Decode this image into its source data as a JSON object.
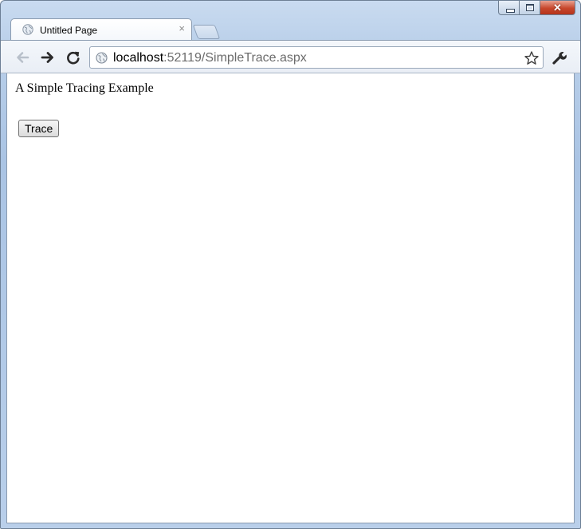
{
  "browser": {
    "tab": {
      "title": "Untitled Page",
      "close_glyph": "×",
      "icon": "globe-icon"
    },
    "window_controls": {
      "close_glyph": "✕"
    },
    "address": {
      "host": "localhost",
      "rest": ":52119/SimpleTrace.aspx",
      "icon": "globe-icon"
    },
    "toolbar_icons": [
      "back-arrow-icon",
      "forward-arrow-icon",
      "reload-icon",
      "star-icon",
      "wrench-icon"
    ]
  },
  "page": {
    "heading": "A Simple Tracing Example",
    "button_label": "Trace"
  },
  "colors": {
    "frame": "#b9cfe9",
    "close_button": "#c7472c"
  }
}
